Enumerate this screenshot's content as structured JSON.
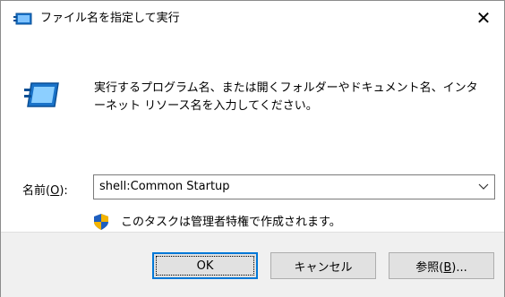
{
  "window": {
    "title": "ファイル名を指定して実行",
    "close_symbol": "✕"
  },
  "description": "実行するプログラム名、または開くフォルダーやドキュメント名、インターネット リソース名を入力してください。",
  "open_field": {
    "label_prefix": "名前(",
    "label_mnemonic": "O",
    "label_suffix": "):",
    "value": "shell:Common Startup"
  },
  "admin_note": "このタスクは管理者特権で作成されます。",
  "buttons": {
    "ok": "OK",
    "cancel": "キャンセル",
    "browse_prefix": "参照(",
    "browse_mnemonic": "B",
    "browse_suffix": ")..."
  },
  "icons": {
    "title": "run-icon",
    "big": "run-icon",
    "admin": "uac-shield-icon",
    "dropdown": "chevron-down-icon"
  },
  "colors": {
    "accent": "#0078d7",
    "footer_bg": "#f0f0f0",
    "button_bg": "#e1e1e1"
  }
}
